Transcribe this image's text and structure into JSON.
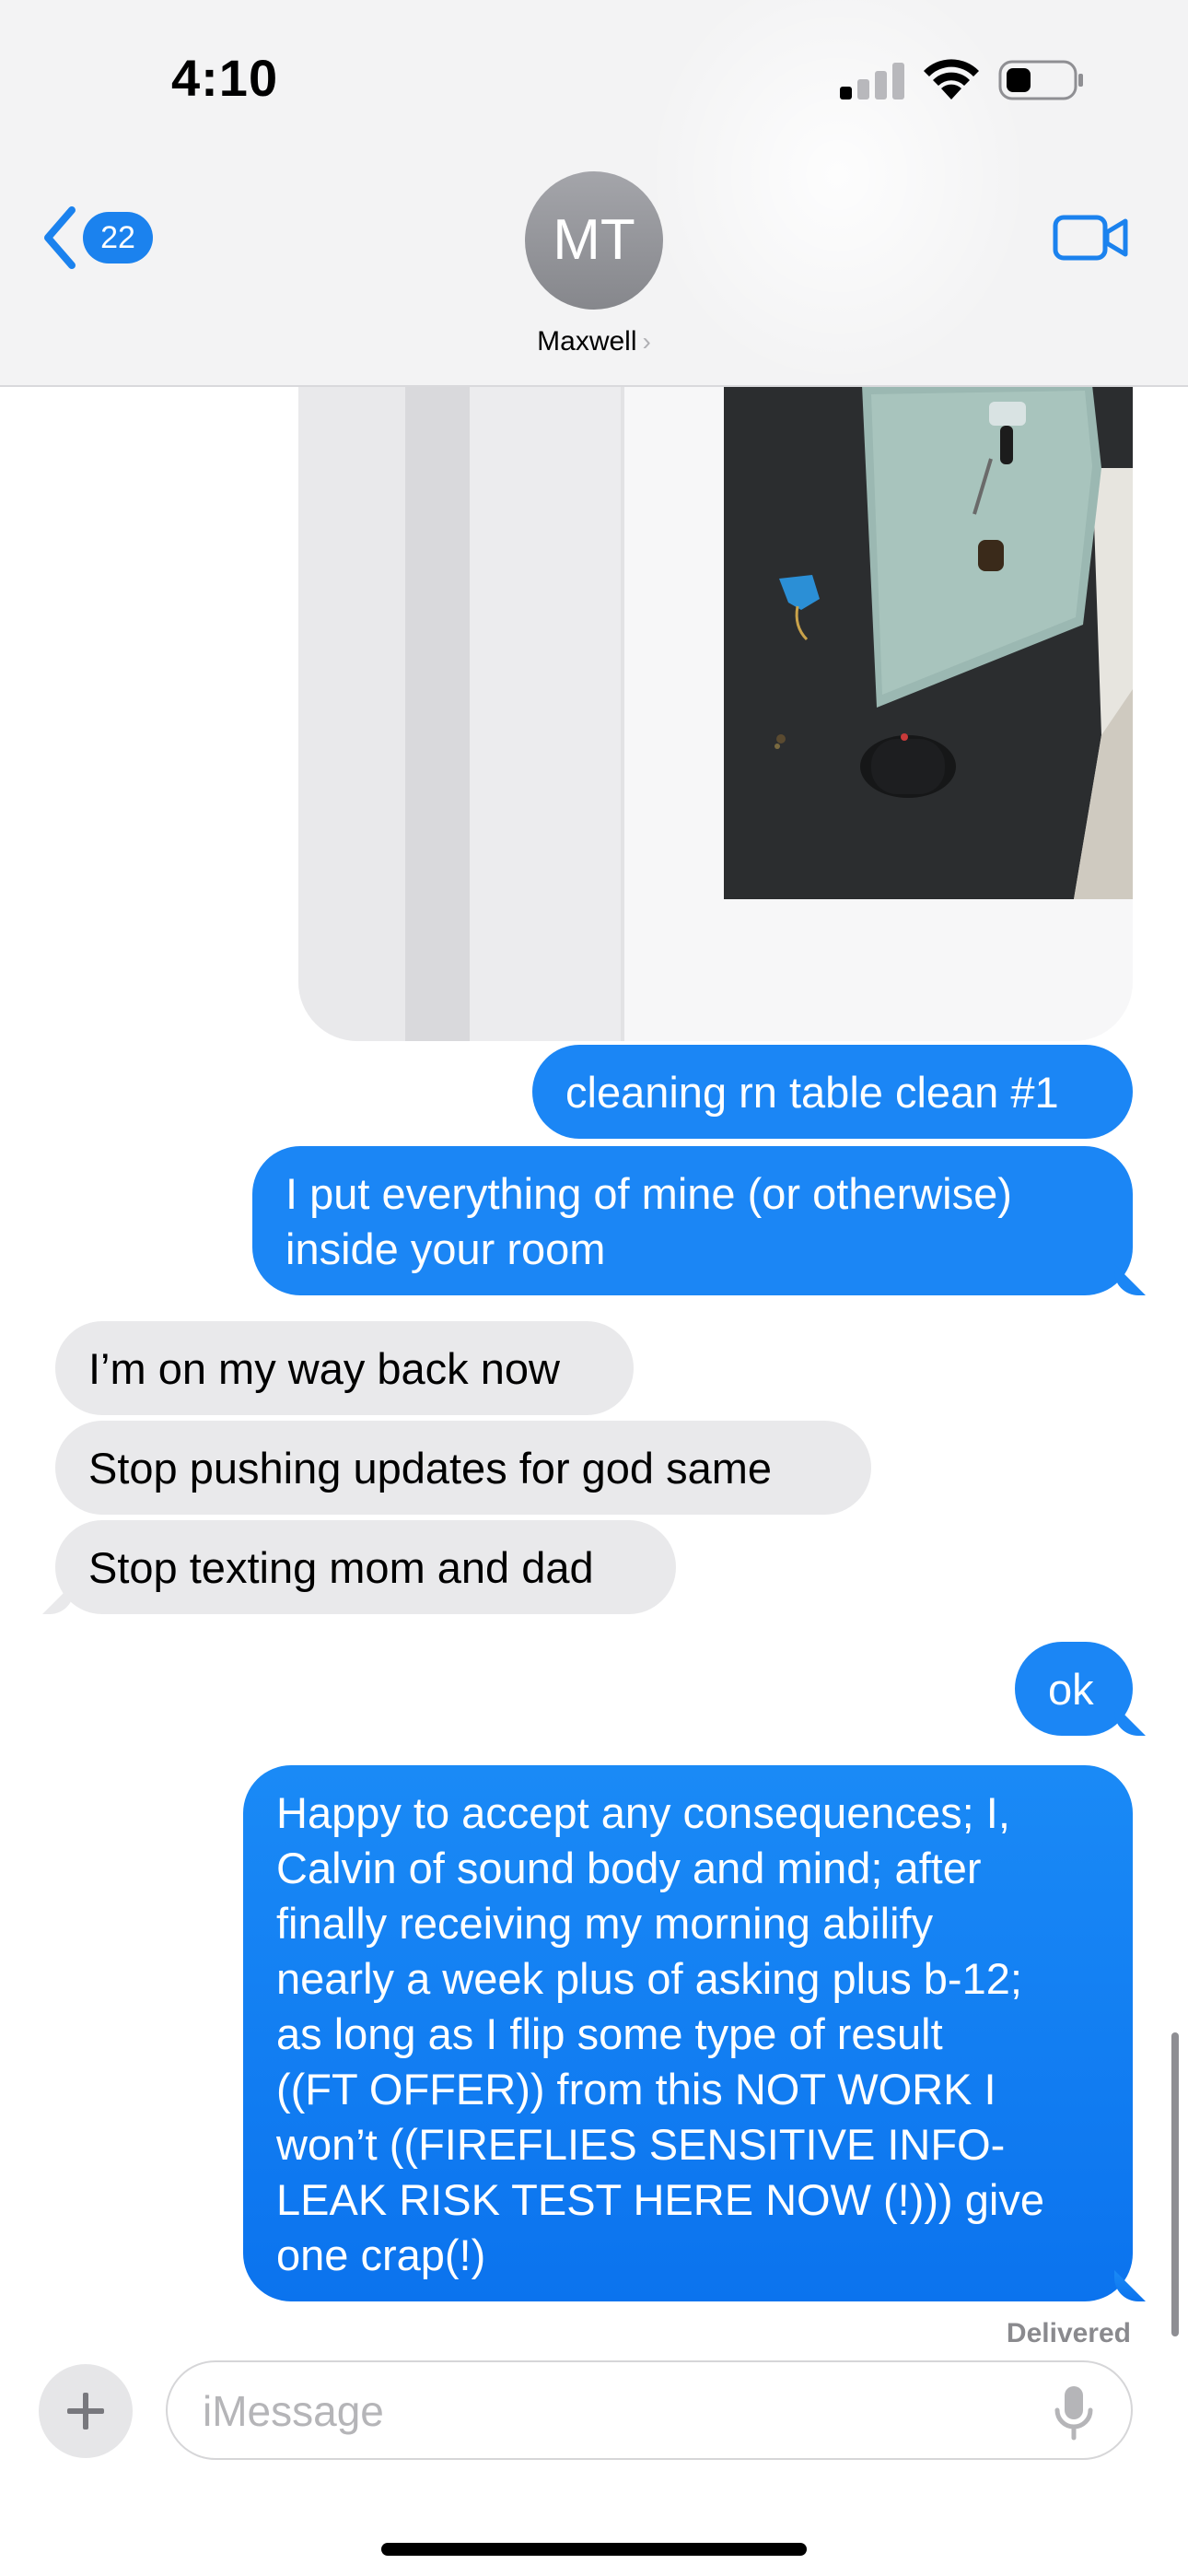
{
  "status_bar": {
    "time": "4:10",
    "signal_bars_active": 1,
    "signal_bars_total": 4
  },
  "header": {
    "back_badge_count": "22",
    "avatar_initials": "MT",
    "contact_name": "Maxwell",
    "chevron": "›",
    "icons": [
      "chevron-left-icon",
      "video-camera-icon",
      "signal-icon",
      "wifi-icon",
      "battery-icon"
    ]
  },
  "messages": [
    {
      "from": "me",
      "text": "cleaning rn table clean #1"
    },
    {
      "from": "me",
      "text": "I put everything of mine (or otherwise)\ninside your room"
    },
    {
      "from": "them",
      "text": "I’m on my way back now"
    },
    {
      "from": "them",
      "text": "Stop pushing updates for god same"
    },
    {
      "from": "them",
      "text": "Stop texting mom and dad"
    },
    {
      "from": "me",
      "text": "ok"
    },
    {
      "from": "me",
      "text": "Happy to accept any consequences; I,\nCalvin of sound body and mind; after\nfinally receiving my morning abilify\nnearly a week plus of asking plus b-12;\nas long as I flip some type of result\n((FT OFFER)) from this NOT WORK I\nwon’t ((FIREFLIES SENSITIVE INFO-\nLEAK RISK TEST HERE NOW (!))) give\none crap(!)"
    }
  ],
  "delivered_label": "Delivered",
  "input": {
    "placeholder": "iMessage",
    "value": ""
  },
  "colors": {
    "sent_bubble": "#1b86f5",
    "received_bubble": "#e9e9eb",
    "accent": "#1b82ee"
  }
}
